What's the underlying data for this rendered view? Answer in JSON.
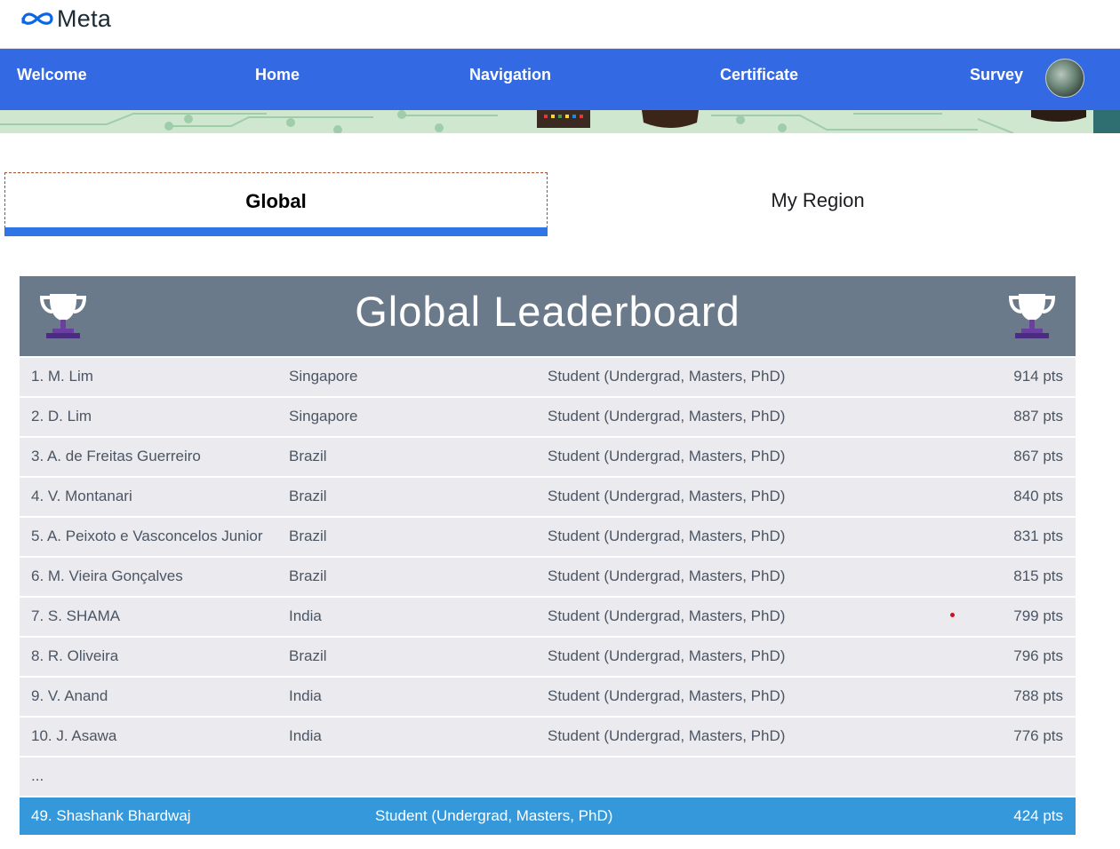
{
  "brand": {
    "logo_text": "Meta",
    "logo_icon": "meta-infinity-icon"
  },
  "nav": {
    "items": [
      {
        "label": "Welcome"
      },
      {
        "label": "Home"
      },
      {
        "label": "Navigation"
      },
      {
        "label": "Certificate"
      },
      {
        "label": "Survey"
      }
    ],
    "avatar_icon": "user-avatar"
  },
  "tabs": {
    "global": "Global",
    "region": "My Region",
    "active": "Global"
  },
  "leaderboard": {
    "title": "Global Leaderboard",
    "trophy_icon": "trophy-icon",
    "rows": [
      {
        "name": "1. M. Lim",
        "country": "Singapore",
        "role": "Student (Undergrad, Masters, PhD)",
        "points": "914 pts"
      },
      {
        "name": "2. D. Lim",
        "country": "Singapore",
        "role": "Student (Undergrad, Masters, PhD)",
        "points": "887 pts"
      },
      {
        "name": "3. A. de Freitas Guerreiro",
        "country": "Brazil",
        "role": "Student (Undergrad, Masters, PhD)",
        "points": "867 pts"
      },
      {
        "name": "4. V. Montanari",
        "country": "Brazil",
        "role": "Student (Undergrad, Masters, PhD)",
        "points": "840 pts"
      },
      {
        "name": "5. A. Peixoto e Vasconcelos Junior",
        "country": "Brazil",
        "role": "Student (Undergrad, Masters, PhD)",
        "points": "831 pts"
      },
      {
        "name": "6. M. Vieira Gonçalves",
        "country": "Brazil",
        "role": "Student (Undergrad, Masters, PhD)",
        "points": "815 pts"
      },
      {
        "name": "7. S. SHAMA",
        "country": "India",
        "role": "Student (Undergrad, Masters, PhD)",
        "points": "799 pts"
      },
      {
        "name": "8. R. Oliveira",
        "country": "Brazil",
        "role": "Student (Undergrad, Masters, PhD)",
        "points": "796 pts"
      },
      {
        "name": "9. V. Anand",
        "country": "India",
        "role": "Student (Undergrad, Masters, PhD)",
        "points": "788 pts"
      },
      {
        "name": "10. J. Asawa",
        "country": "India",
        "role": "Student (Undergrad, Masters, PhD)",
        "points": "776 pts"
      }
    ],
    "ellipsis": "...",
    "current_user": {
      "name": "49. Shashank Bhardwaj",
      "role": "Student (Undergrad, Masters, PhD)",
      "points": "424 pts"
    }
  },
  "colors": {
    "nav_blue": "#3469e4",
    "tab_underline": "#2f75e5",
    "header_slate": "#6b7a8b",
    "row_bg": "#ebebef",
    "highlight_row": "#3498db",
    "trophy_purple": "#6b3fa0"
  }
}
